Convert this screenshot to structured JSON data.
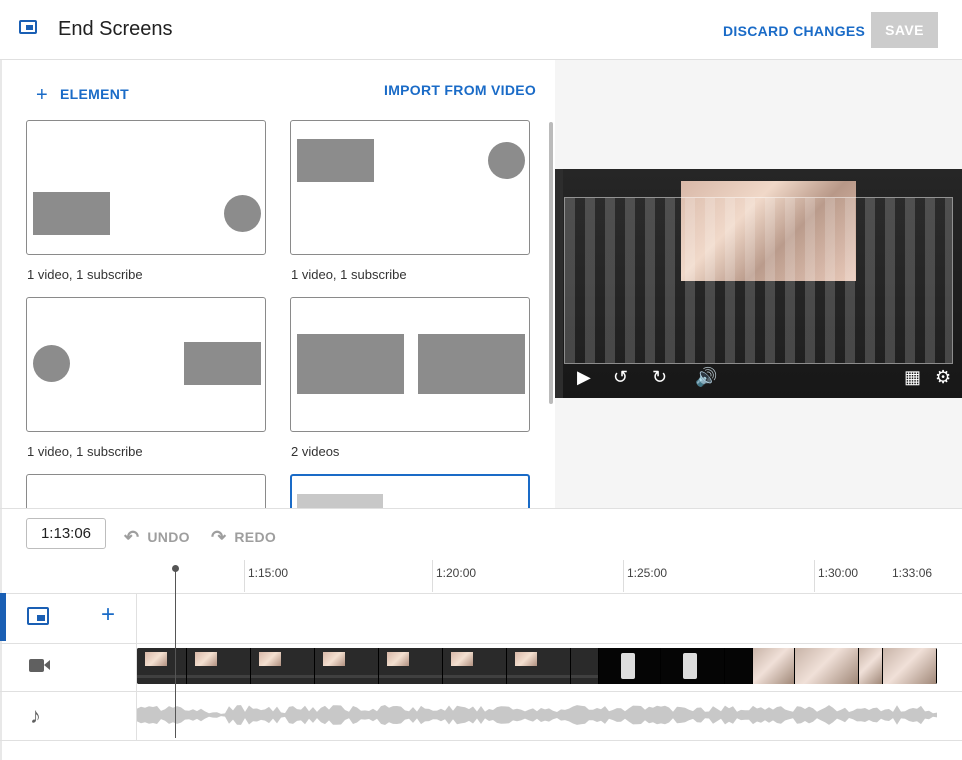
{
  "header": {
    "title": "End Screens",
    "discard_label": "DISCARD CHANGES",
    "save_label": "SAVE"
  },
  "toolbar": {
    "add_element_label": "ELEMENT",
    "import_label": "IMPORT FROM VIDEO"
  },
  "templates": [
    {
      "caption": "1 video, 1 subscribe"
    },
    {
      "caption": "1 video, 1 subscribe"
    },
    {
      "caption": "1 video, 1 subscribe"
    },
    {
      "caption": "2 videos"
    },
    {
      "caption": ""
    },
    {
      "caption": ""
    }
  ],
  "timeline": {
    "current_time": "1:13:06",
    "undo_label": "UNDO",
    "redo_label": "REDO",
    "ruler_ticks": [
      "1:15:00",
      "1:20:00",
      "1:25:00",
      "1:30:00",
      "1:33:06"
    ]
  },
  "icons": {
    "end_screen": "end-screen-icon",
    "add": "plus-icon",
    "video_track": "videocam-icon",
    "audio_track": "music-note-icon",
    "play": "play-icon",
    "rewind": "replay-10-icon",
    "forward": "forward-10-icon",
    "volume": "volume-icon",
    "grid": "grid-icon",
    "settings": "gear-icon"
  },
  "colors": {
    "accent": "#1a6bc7",
    "disabled": "#cccccc"
  }
}
